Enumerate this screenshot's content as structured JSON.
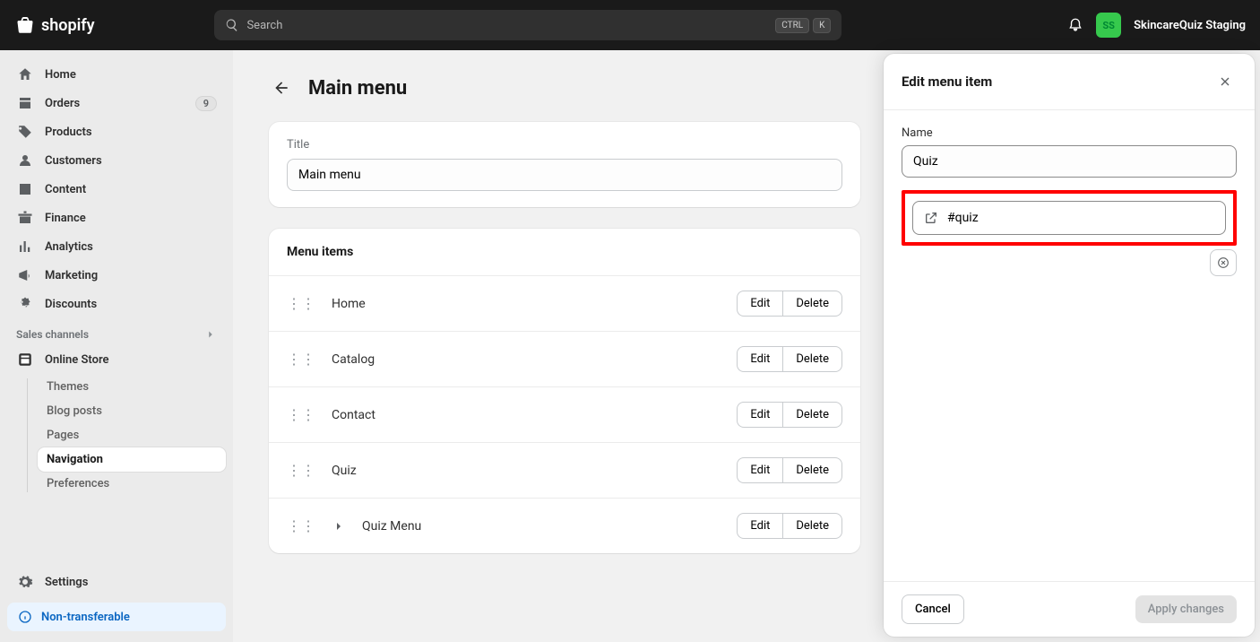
{
  "brand": "shopify",
  "search_placeholder": "Search",
  "kbd": {
    "ctrl": "CTRL",
    "k": "K"
  },
  "store": {
    "initials": "SS",
    "name": "SkincareQuiz Staging"
  },
  "nav": {
    "home": "Home",
    "orders": "Orders",
    "orders_badge": "9",
    "products": "Products",
    "customers": "Customers",
    "content": "Content",
    "finance": "Finance",
    "analytics": "Analytics",
    "marketing": "Marketing",
    "discounts": "Discounts",
    "sales_channels": "Sales channels",
    "online_store": "Online Store",
    "themes": "Themes",
    "blog_posts": "Blog posts",
    "pages": "Pages",
    "navigation": "Navigation",
    "preferences": "Preferences",
    "settings": "Settings",
    "non_transferable": "Non-transferable"
  },
  "page": {
    "title": "Main menu",
    "title_label": "Title",
    "title_value": "Main menu",
    "menu_items_heading": "Menu items"
  },
  "actions": {
    "edit": "Edit",
    "delete": "Delete"
  },
  "menu_items": [
    {
      "label": "Home"
    },
    {
      "label": "Catalog"
    },
    {
      "label": "Contact"
    },
    {
      "label": "Quiz"
    },
    {
      "label": "Quiz Menu",
      "nested": true
    }
  ],
  "drawer": {
    "title": "Edit menu item",
    "name_label": "Name",
    "name_value": "Quiz",
    "link_value": "#quiz",
    "cancel": "Cancel",
    "apply": "Apply changes"
  }
}
